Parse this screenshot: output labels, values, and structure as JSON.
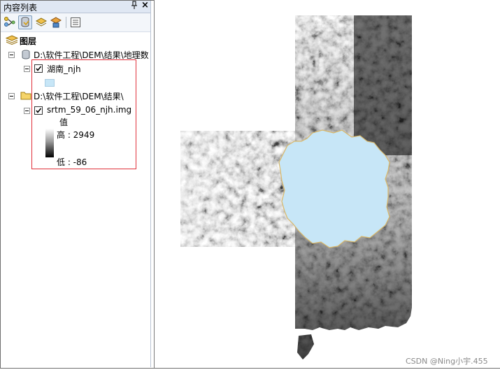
{
  "panel": {
    "title": "内容列表",
    "pin_glyph": "ᵖ",
    "close_glyph": "×"
  },
  "toolbar": {
    "buttons": [
      {
        "icon": "list-by-drawing-order-icon"
      },
      {
        "icon": "list-by-source-icon"
      },
      {
        "icon": "list-by-visibility-icon"
      },
      {
        "icon": "list-by-selection-icon"
      },
      {
        "icon": "options-icon"
      }
    ]
  },
  "toc": {
    "root_label": "图层",
    "groups": [
      {
        "path": "D:\\软件工程\\DEM\\结果\\地理数",
        "layers": [
          {
            "name": "湖南_njh",
            "checked": true,
            "symbol_color": "#c7e6f7"
          }
        ]
      },
      {
        "path": "D:\\软件工程\\DEM\\结果\\",
        "layers": [
          {
            "name": "srtm_59_06_njh.img",
            "checked": true,
            "legend": {
              "title": "值",
              "high": "高 : 2949",
              "low": "低 : -86"
            }
          }
        ]
      }
    ]
  },
  "map": {
    "lake_color": "#c7e6f7",
    "background": "#ffffff"
  },
  "watermark": "CSDN @Ning小宇.455"
}
